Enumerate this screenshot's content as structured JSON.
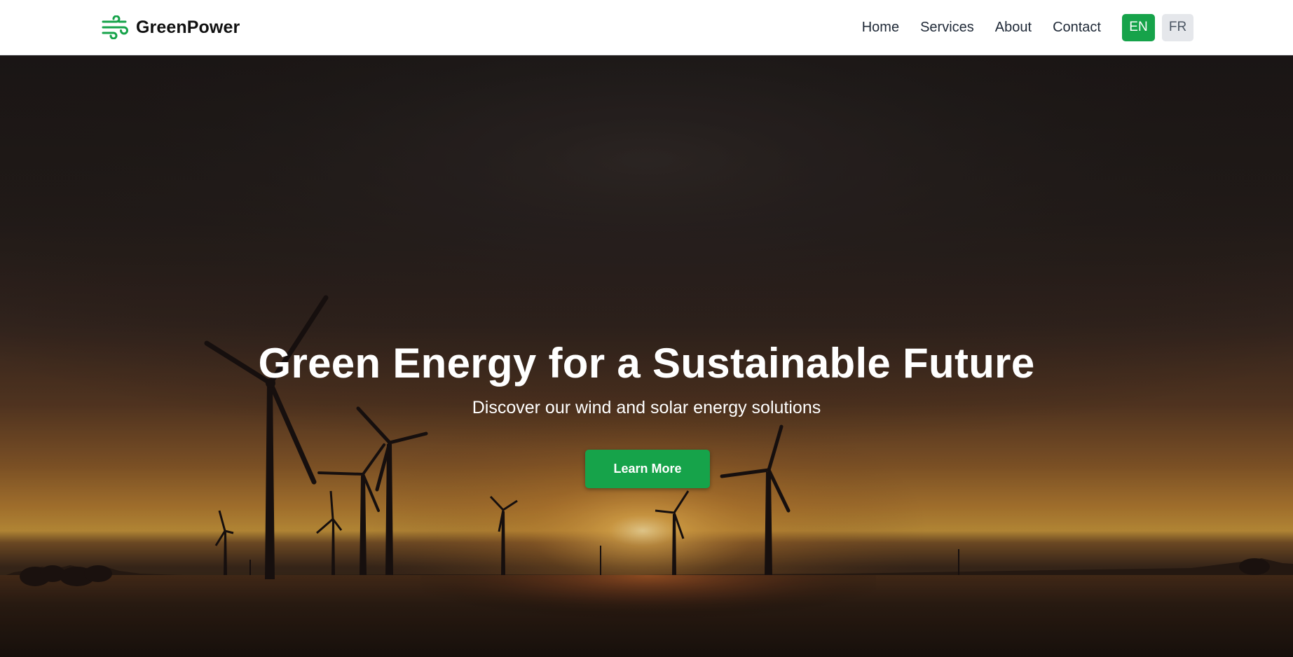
{
  "brand": {
    "name": "GreenPower",
    "icon": "wind-icon",
    "color": "#16a34a"
  },
  "nav": {
    "items": [
      {
        "label": "Home"
      },
      {
        "label": "Services"
      },
      {
        "label": "About"
      },
      {
        "label": "Contact"
      }
    ]
  },
  "language": {
    "options": [
      {
        "label": "EN",
        "active": true
      },
      {
        "label": "FR",
        "active": false
      }
    ]
  },
  "hero": {
    "title": "Green Energy for a Sustainable Future",
    "subtitle": "Discover our wind and solar energy solutions",
    "cta_label": "Learn More",
    "background": "wind-turbines-sunset-image"
  },
  "colors": {
    "accent": "#16a34a",
    "inactive_button": "#e5e7eb"
  }
}
